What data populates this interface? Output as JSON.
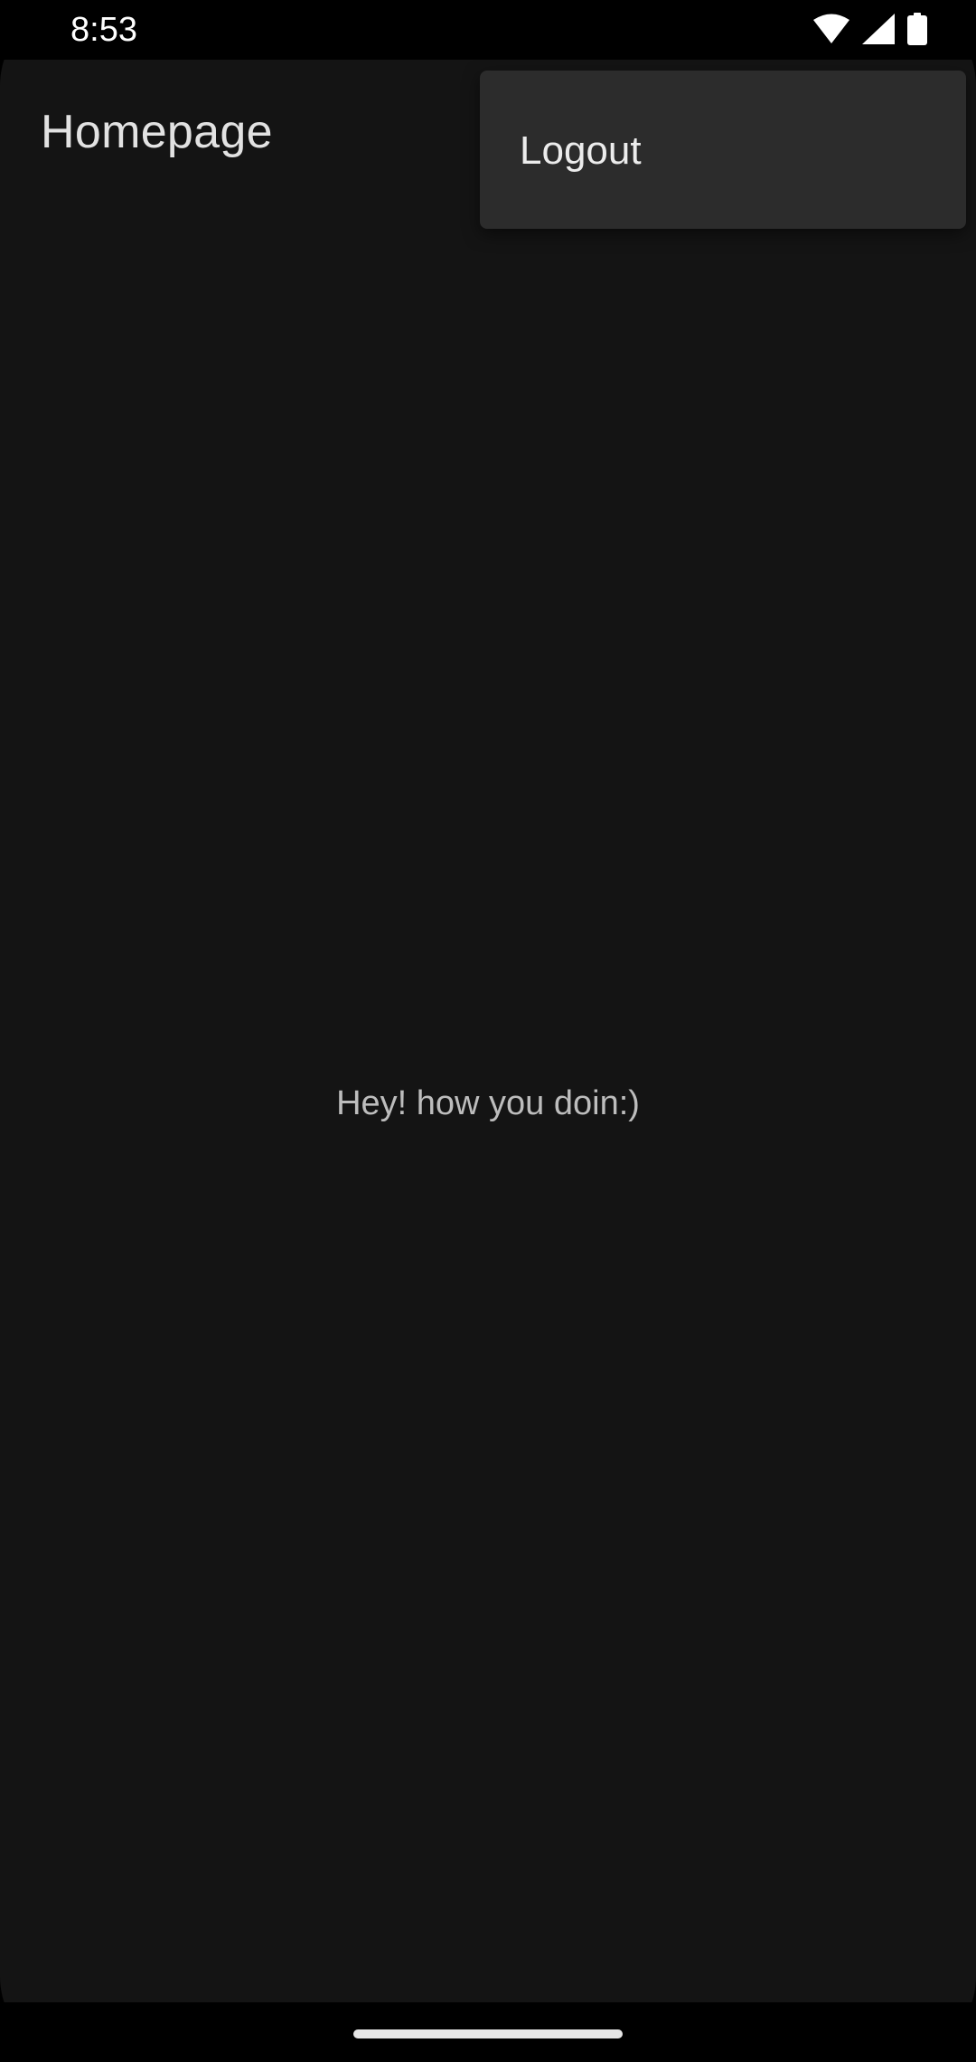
{
  "status_bar": {
    "time": "8:53",
    "icons": [
      "wifi-icon",
      "cellular-signal-icon",
      "battery-icon"
    ]
  },
  "app_bar": {
    "title": "Homepage"
  },
  "overflow_menu": {
    "items": [
      {
        "label": "Logout"
      }
    ]
  },
  "main": {
    "message": "Hey! how you doin:)"
  },
  "colors": {
    "background": "#141414",
    "menu_background": "#2c2c2c",
    "title_text": "#e2e2e2",
    "body_text": "#bdbdbd"
  }
}
